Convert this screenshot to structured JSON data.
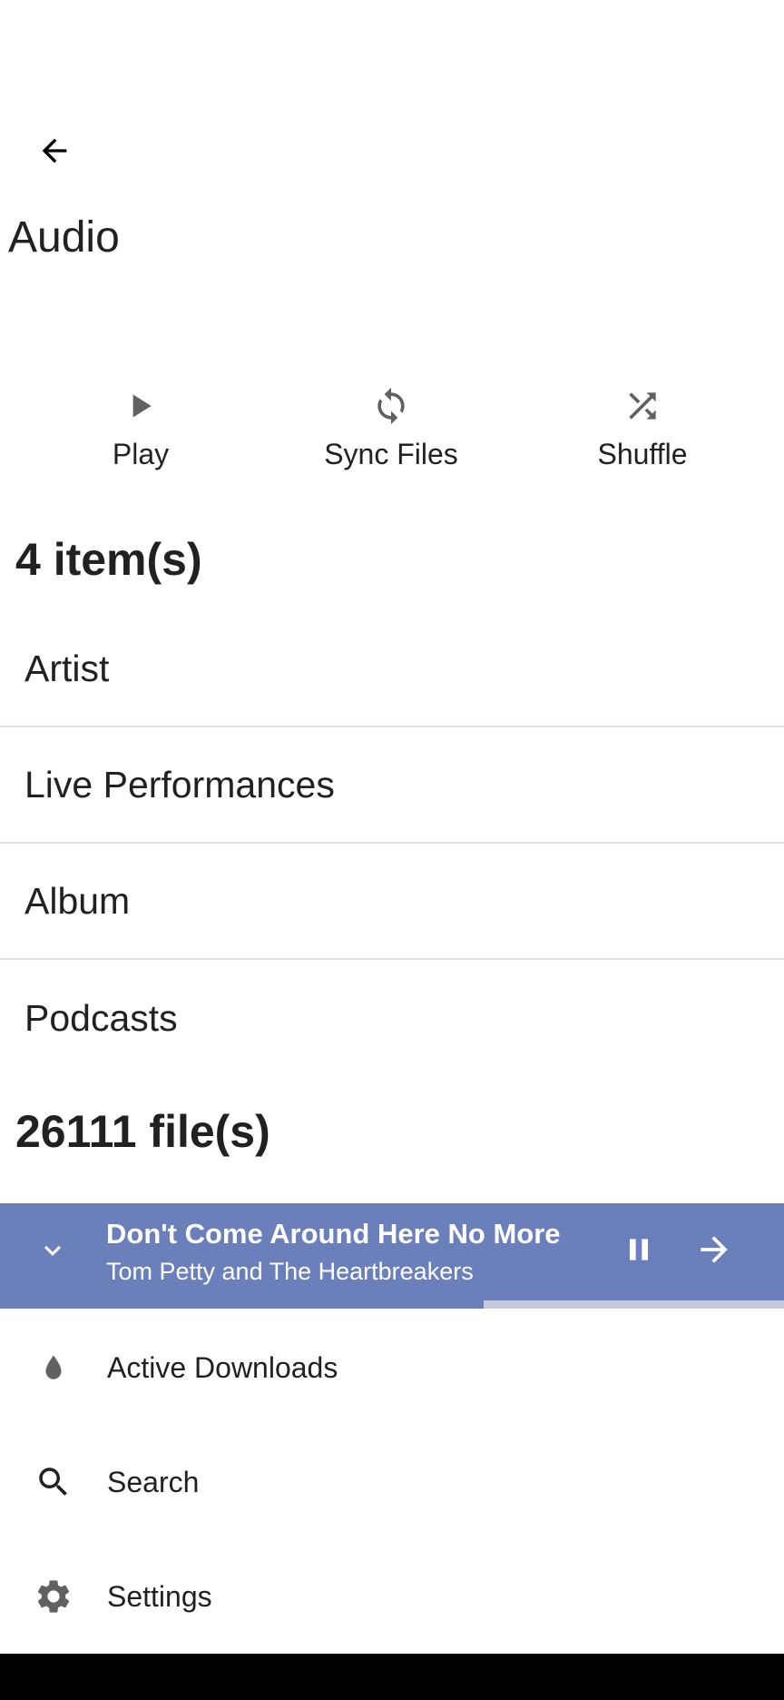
{
  "header": {
    "title": "Audio",
    "back_icon": "arrow-back-icon"
  },
  "actions": [
    {
      "label": "Play",
      "icon": "play-icon"
    },
    {
      "label": "Sync Files",
      "icon": "sync-icon"
    },
    {
      "label": "Shuffle",
      "icon": "shuffle-icon"
    }
  ],
  "items_heading": "4 item(s)",
  "list": [
    {
      "label": "Artist"
    },
    {
      "label": "Live Performances"
    },
    {
      "label": "Album"
    },
    {
      "label": "Podcasts"
    }
  ],
  "files_heading": "26111 file(s)",
  "now_playing": {
    "title": "Don't Come Around Here No More",
    "artist": "Tom Petty and The Heartbreakers",
    "progress_percent": 61.7,
    "bar_color": "#6b7fba",
    "track_color": "#c4c9e0"
  },
  "nav": [
    {
      "label": "Active Downloads",
      "icon": "drop-icon"
    },
    {
      "label": "Search",
      "icon": "search-icon"
    },
    {
      "label": "Settings",
      "icon": "gear-icon"
    }
  ]
}
